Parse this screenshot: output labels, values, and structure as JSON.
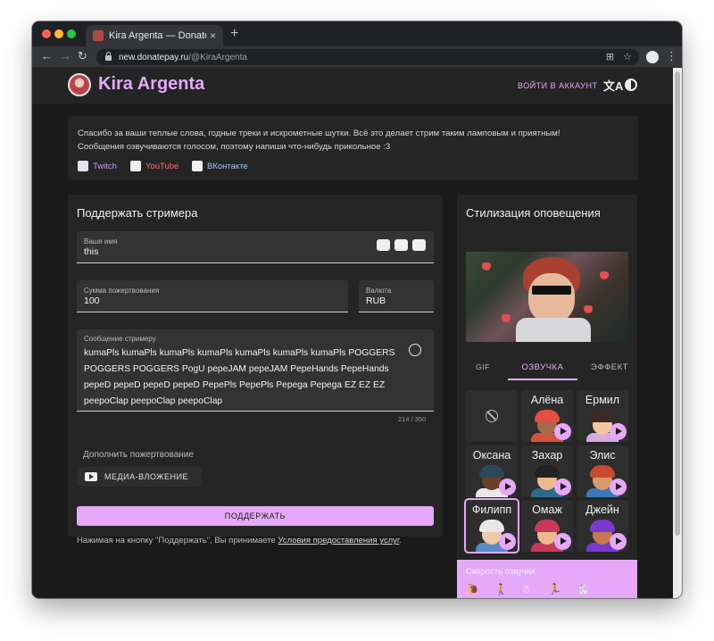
{
  "browser": {
    "tab_title": "Kira Argenta — DonatePay",
    "tab_close": "×",
    "new_tab": "+",
    "url_host": "new.donatepay.ru",
    "url_path": "/@KiraArgenta"
  },
  "header": {
    "brand": "Kira Argenta",
    "login": "ВОЙТИ В АККАУНТ",
    "translate_glyph": "文A"
  },
  "about": {
    "text": "Спасибо за ваши теплые слова, годные треки и искрометные шутки. Всё это делает стрим таким ламповым и приятным! Сообщения озвучиваются голосом, поэтому напиши что-нибудь прикольное :3",
    "links": [
      {
        "label": "Twitch",
        "icon": "twitch-icon",
        "color": "#c59cf6"
      },
      {
        "label": "YouTube",
        "icon": "youtube-icon",
        "color": "#ff6d6d"
      },
      {
        "label": "ВКонтакте",
        "icon": "vk-icon",
        "color": "#9ec6f2"
      }
    ]
  },
  "form": {
    "title": "Поддержать стримера",
    "name_label": "Ваше имя",
    "name_value": "this",
    "amount_label": "Сумма пожертвования",
    "amount_value": "100",
    "currency_label": "Валюта",
    "currency_value": "RUB",
    "message_label": "Сообщение стримеру",
    "message_value": "kumaPls kumaPls kumaPls kumaPls kumaPls kumaPls kumaPls POGGERS POGGERS POGGERS PogU pepeJAM pepeJAM PepeHands PepeHands pepeD pepeD pepeD pepeD PepePls PepePls Pepega Pepega EZ EZ EZ peepoClap peepoClap peepoClap",
    "message_counter": "214 / 350",
    "addon_label": "Дополнить пожертвование",
    "media_button": "МЕДИА-ВЛОЖЕНИЕ",
    "submit": "ПОДДЕРЖАТЬ",
    "terms_prefix": "Нажимая на кнопку \"Поддержать\", Вы принимаете ",
    "terms_link": "Условия предоставления услуг",
    "terms_suffix": "."
  },
  "alerts": {
    "title": "Стилизация оповещения",
    "tabs": [
      "GIF",
      "ОЗВУЧКА",
      "ЭФФЕКТ"
    ],
    "active_tab": "ОЗВУЧКА",
    "voices": [
      {
        "name": "",
        "type": "none"
      },
      {
        "name": "Алёна",
        "hair": "#e25040",
        "skin": "#a8684a",
        "body": "#d2543c"
      },
      {
        "name": "Ермил",
        "hair": "#3a2a22",
        "skin": "#f2c69c",
        "body": "#d8a8e0"
      },
      {
        "name": "Оксана",
        "hair": "#2a4a5a",
        "skin": "#6a4028",
        "body": "#e8e8e8"
      },
      {
        "name": "Захар",
        "hair": "#222222",
        "skin": "#f0b890",
        "body": "#2a6a8a"
      },
      {
        "name": "Элис",
        "hair": "#c84a30",
        "skin": "#d89a6a",
        "body": "#3a7ab8"
      },
      {
        "name": "Филипп",
        "hair": "#e8e8e8",
        "skin": "#f0c8a8",
        "body": "#5a8ac8"
      },
      {
        "name": "Омаж",
        "hair": "#c83a5a",
        "skin": "#f0b890",
        "body": "#c83a5a"
      },
      {
        "name": "Джейн",
        "hair": "#7a3ad0",
        "skin": "#c87850",
        "body": "#7a3ad0"
      }
    ],
    "selected_voice": "Филипп",
    "speed_title": "Скорость озвучки",
    "speeds": [
      {
        "glyph": "🐌",
        "icon": "snail-icon"
      },
      {
        "glyph": "🚶",
        "icon": "walk-icon"
      },
      {
        "glyph": "☃",
        "icon": "snowman-icon"
      },
      {
        "glyph": "🏃",
        "icon": "run-icon"
      },
      {
        "glyph": "🐇",
        "icon": "rabbit-icon"
      }
    ],
    "active_speed": 2
  }
}
